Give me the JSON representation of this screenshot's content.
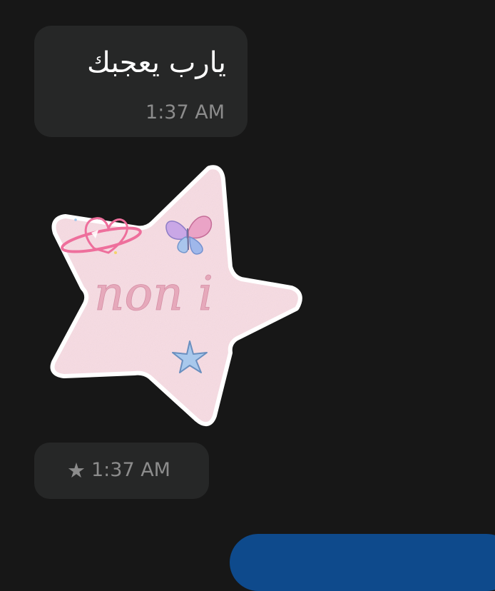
{
  "messages": [
    {
      "type": "text",
      "text": "يارب يعجبك",
      "time": "1:37 AM"
    },
    {
      "type": "sticker",
      "sticker_text": "non i",
      "star": "★",
      "time": "1:37 AM"
    }
  ],
  "colors": {
    "background": "#171717",
    "bubble": "#262727",
    "timestamp": "#8c8c8c",
    "outgoing_bubble": "#0e4a8c",
    "sticker_fill": "#f7dce3",
    "sticker_text": "#e6a9bb"
  },
  "icons": {
    "sticker_decor": [
      "heart-planet-icon",
      "butterfly-icon",
      "small-star-icon"
    ],
    "starred": "star-icon"
  }
}
